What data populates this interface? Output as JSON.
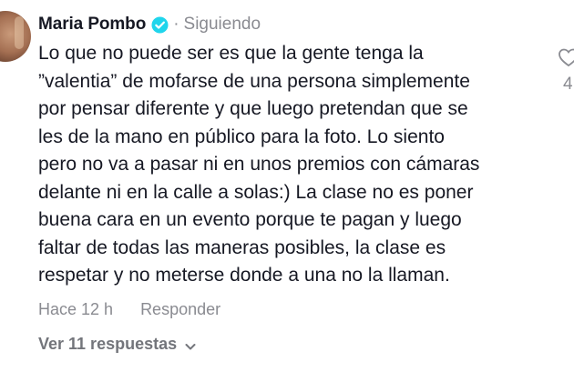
{
  "comment": {
    "author": "Maria Pombo",
    "separator": "·",
    "following_label": "Siguiendo",
    "text": "Lo que no puede ser es que la gente tenga la\n”valentia” de mofarse de una persona simplemente\npor pensar diferente y que luego pretendan que se\nles de la mano en público para la foto. Lo siento\npero no va a pasar ni en unos premios con cámaras\ndelante ni en la calle a solas:) La clase no es poner\nbuena cara en un evento porque te pagan y luego\nfaltar de todas las maneras posibles, la clase es\nrespetar y no meterse donde a una no la llaman.",
    "timestamp": "Hace 12 h",
    "reply_label": "Responder",
    "view_replies_label": "Ver 11 respuestas",
    "like_count_partial": "4"
  },
  "icons": {
    "verified": "verified-badge-icon",
    "chevron": "chevron-down-icon",
    "like": "heart-icon"
  },
  "colors": {
    "verified_badge": "#20d5ec",
    "text_primary": "#161823",
    "text_secondary": "#8a8b91"
  }
}
